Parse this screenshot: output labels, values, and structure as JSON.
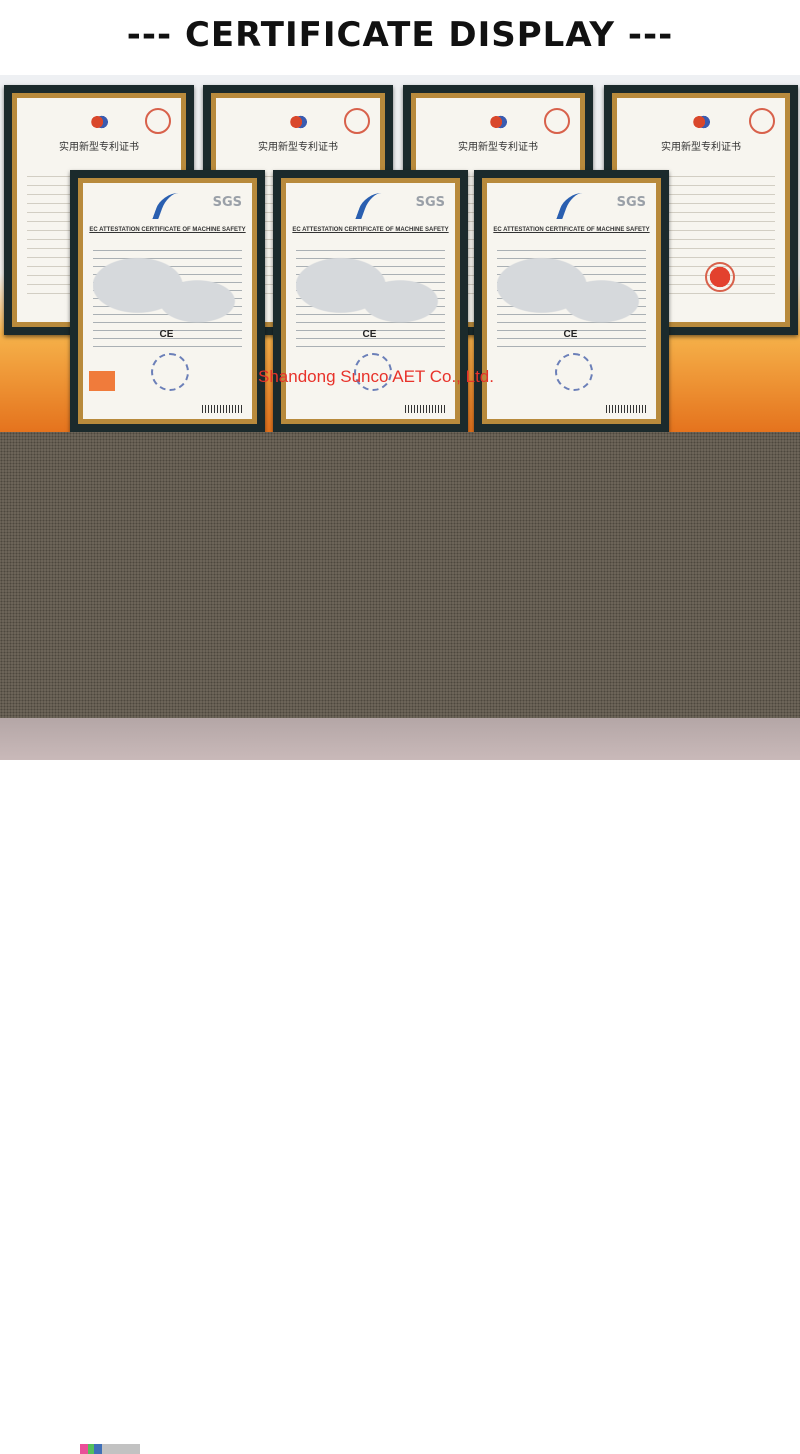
{
  "page": {
    "heading": "--- CERTIFICATE DISPLAY ---",
    "watermark": "Shandong Sunco AET Co., Ltd."
  },
  "certificates": {
    "patent_title": "实用新型专利证书",
    "sgs_brand": "SGS",
    "sgs_title": "EC ATTESTATION CERTIFICATE OF MACHINE SAFETY",
    "ce_mark": "CE"
  },
  "colors": {
    "frame": "#1b2a2c",
    "mat": "#b88a3c",
    "banner_orange": "#e4711c",
    "watermark_red": "#e8322a",
    "dotted_area": "#6f675a"
  }
}
